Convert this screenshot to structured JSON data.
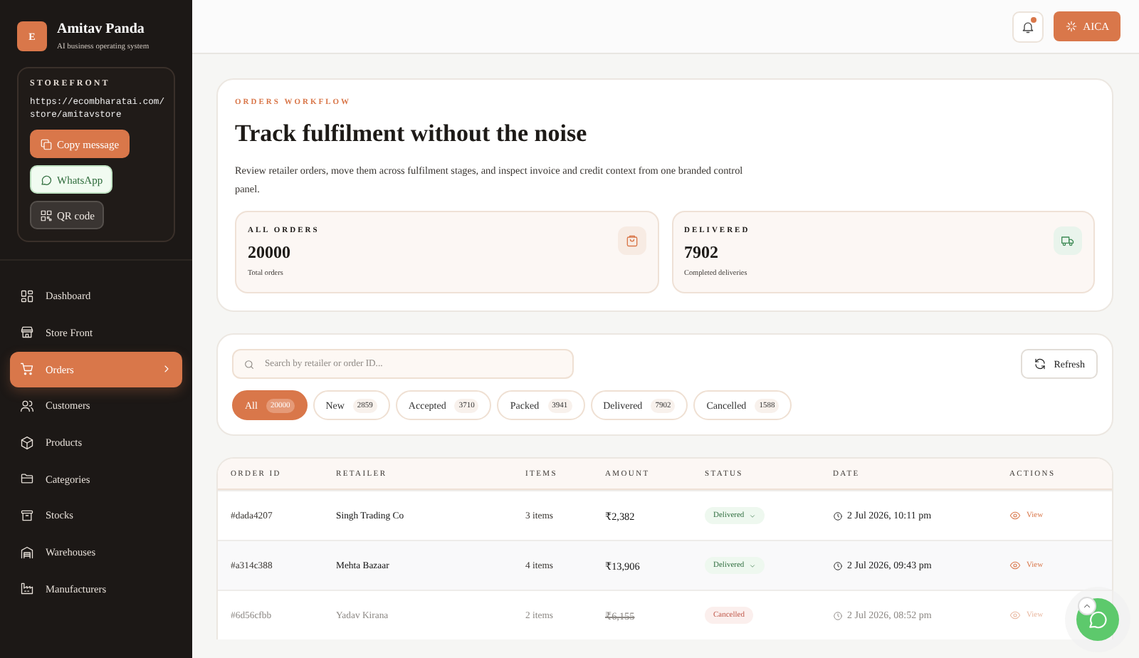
{
  "sidebar": {
    "brand": {
      "initial": "E",
      "name": "Amitav Panda",
      "tagline": "AI business operating system"
    },
    "storefront": {
      "heading": "STOREFRONT",
      "url": "https://ecombharatai.com/store/amitavstore",
      "buttons": [
        {
          "kind": "copy",
          "label": "Copy message"
        },
        {
          "kind": "whatsapp",
          "label": "WhatsApp"
        },
        {
          "kind": "qr",
          "label": "QR code"
        }
      ]
    },
    "nav": [
      {
        "label": "Dashboard",
        "selected": false
      },
      {
        "label": "Store Front",
        "selected": false
      },
      {
        "label": "Orders",
        "selected": true
      },
      {
        "label": "Customers",
        "selected": false
      },
      {
        "label": "Products",
        "selected": false
      },
      {
        "label": "Categories",
        "selected": false
      },
      {
        "label": "Stocks",
        "selected": false
      },
      {
        "label": "Warehouses",
        "selected": false
      },
      {
        "label": "Manufacturers",
        "selected": false
      }
    ]
  },
  "topbar": {
    "notification_unread": true,
    "assistant_button": "AICA"
  },
  "hero": {
    "eyebrow": "ORDERS WORKFLOW",
    "title": "Track fulfilment without the noise",
    "description": "Review retailer orders, move them across fulfilment stages, and inspect invoice and credit context from one branded control panel.",
    "stats": [
      {
        "kind": "orders",
        "label": "ALL ORDERS",
        "value": "20000",
        "caption": "Total orders"
      },
      {
        "kind": "delivered",
        "label": "DELIVERED",
        "value": "7902",
        "caption": "Completed deliveries"
      }
    ]
  },
  "filters": {
    "search": {
      "placeholder": "Search by retailer or order ID..."
    },
    "refresh_button": "Refresh",
    "chips": [
      {
        "label": "All",
        "count": "20000",
        "selected": true
      },
      {
        "label": "New",
        "count": "2859",
        "selected": false
      },
      {
        "label": "Accepted",
        "count": "3710",
        "selected": false
      },
      {
        "label": "Packed",
        "count": "3941",
        "selected": false
      },
      {
        "label": "Delivered",
        "count": "7902",
        "selected": false
      },
      {
        "label": "Cancelled",
        "count": "1588",
        "selected": false
      }
    ]
  },
  "table": {
    "columns": [
      "ORDER ID",
      "RETAILER",
      "ITEMS",
      "AMOUNT",
      "STATUS",
      "DATE",
      "ACTIONS"
    ],
    "rows": [
      {
        "order_id": "#dada4207",
        "retailer": "Singh Trading Co",
        "items": "3 items",
        "amount": "₹2,382",
        "status": {
          "kind": "delivered",
          "label": "Delivered"
        },
        "date": "2 Jul 2026, 10:11 pm",
        "action": "View"
      },
      {
        "order_id": "#a314c388",
        "retailer": "Mehta Bazaar",
        "items": "4 items",
        "amount": "₹13,906",
        "status": {
          "kind": "delivered",
          "label": "Delivered"
        },
        "date": "2 Jul 2026, 09:43 pm",
        "action": "View"
      },
      {
        "order_id": "#6d56cfbb",
        "retailer": "Yadav Kirana",
        "items": "2 items",
        "amount": "₹6,155",
        "status": {
          "kind": "cancelled",
          "label": "Cancelled"
        },
        "date": "2 Jul 2026, 08:52 pm",
        "action": "View"
      }
    ]
  }
}
